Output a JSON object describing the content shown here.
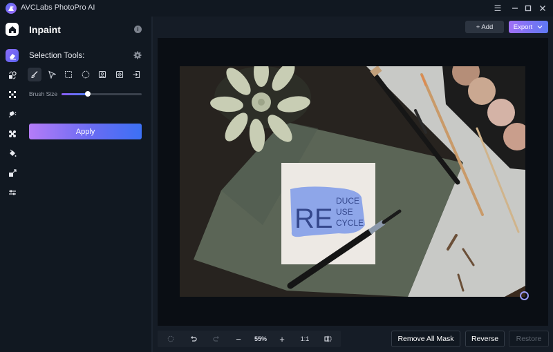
{
  "app": {
    "title": "AVCLabs PhotoPro AI",
    "logo_icon": "avclabs-logo-icon",
    "window_controls": [
      {
        "name": "menu-icon",
        "glyph": "☰"
      },
      {
        "name": "minimize-icon",
        "glyph": "—"
      },
      {
        "name": "maximize-icon",
        "glyph": "☐"
      },
      {
        "name": "close-icon",
        "glyph": "✕"
      }
    ]
  },
  "rail": {
    "items": [
      {
        "name": "home",
        "icon": "home-icon"
      },
      {
        "name": "inpaint",
        "icon": "eraser-icon",
        "active": true
      },
      {
        "name": "face-swap",
        "icon": "face-swap-icon"
      },
      {
        "name": "enhance",
        "icon": "enhance-icon"
      },
      {
        "name": "colorize",
        "icon": "colorize-icon"
      },
      {
        "name": "background",
        "icon": "background-icon"
      },
      {
        "name": "fill",
        "icon": "paint-bucket-icon"
      },
      {
        "name": "upscale",
        "icon": "upscale-icon"
      },
      {
        "name": "adjust",
        "icon": "adjust-icon"
      }
    ]
  },
  "panel": {
    "title": "Inpaint",
    "info_glyph": "i",
    "selection_tools_label": "Selection Tools:",
    "tools": [
      {
        "name": "brush-tool",
        "icon": "brush-icon",
        "active": true
      },
      {
        "name": "polygon-tool",
        "icon": "polygon-lasso-icon"
      },
      {
        "name": "rectangle-tool",
        "icon": "rectangle-select-icon"
      },
      {
        "name": "ellipse-tool",
        "icon": "ellipse-select-icon"
      },
      {
        "name": "portrait-tool",
        "icon": "portrait-select-icon"
      },
      {
        "name": "auto-select-tool",
        "icon": "auto-select-icon"
      },
      {
        "name": "import-mask-tool",
        "icon": "import-mask-icon"
      }
    ],
    "brush_size_label": "Brush Size",
    "brush_size_fraction": 0.33,
    "apply_label": "Apply"
  },
  "header": {
    "add_label": "+ Add",
    "export_label": "Export"
  },
  "photo": {
    "note_text_big": "RE",
    "note_lines": [
      "DUCE",
      "USE",
      "CYCLE"
    ]
  },
  "toolbar": {
    "zoom_level": "55%",
    "zoom_out": "−",
    "zoom_in": "+",
    "actual_size": "1:1"
  },
  "actions": {
    "remove_all_mask": "Remove All Mask",
    "reverse": "Reverse",
    "restore": "Restore"
  }
}
